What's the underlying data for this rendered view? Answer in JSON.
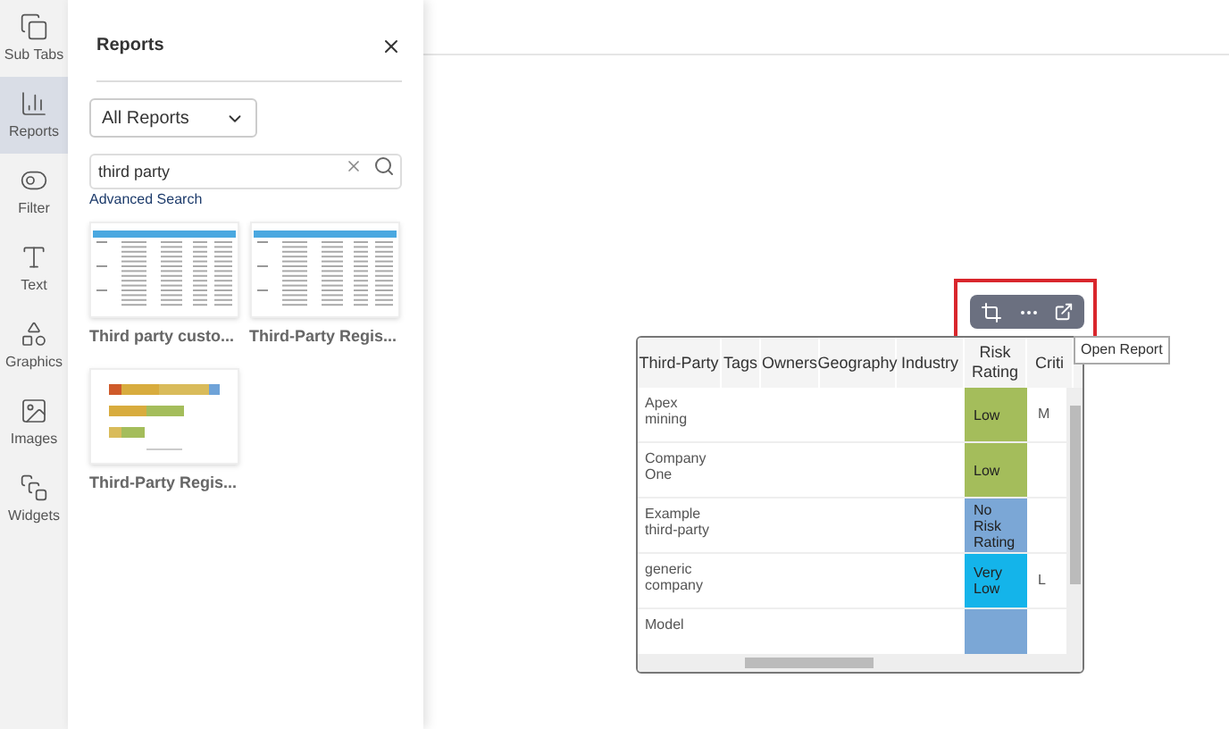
{
  "rail": [
    {
      "label": "Sub Tabs",
      "selected": false
    },
    {
      "label": "Reports",
      "selected": true
    },
    {
      "label": "Filter",
      "selected": false
    },
    {
      "label": "Text",
      "selected": false
    },
    {
      "label": "Graphics",
      "selected": false
    },
    {
      "label": "Images",
      "selected": false
    },
    {
      "label": "Widgets",
      "selected": false
    }
  ],
  "panel": {
    "title": "Reports",
    "filter": "All Reports",
    "search": {
      "value": "third party"
    },
    "advanced_search": "Advanced Search",
    "reports": [
      {
        "kind": "table",
        "title": "Third party custo..."
      },
      {
        "kind": "table",
        "title": "Third-Party Regis..."
      },
      {
        "kind": "bar",
        "title": "Third-Party Regis..."
      }
    ]
  },
  "widget": {
    "tooltip": "Open Report",
    "columns": [
      "Third-Party",
      "Tags",
      "Owners",
      "Geography",
      "Industry",
      "Risk Rating",
      "Criti"
    ],
    "rows": [
      {
        "name": "Apex mining",
        "risk": "Low",
        "color": "#a4bd5b",
        "criticality": "M"
      },
      {
        "name": "Company One",
        "risk": "Low",
        "color": "#a4bd5b"
      },
      {
        "name": "Example third-party",
        "risk": "No Risk Rating",
        "color": "#7ba7d6"
      },
      {
        "name": "generic company",
        "risk": "Very Low",
        "color": "#14b4ea",
        "criticality": "L"
      },
      {
        "name": "Model",
        "color": "#7ba7d6"
      }
    ]
  }
}
